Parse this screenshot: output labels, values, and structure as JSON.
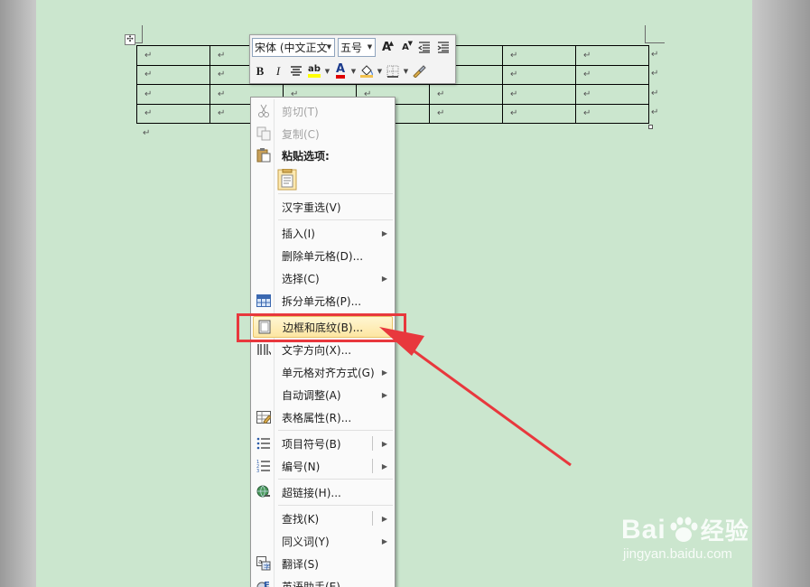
{
  "document": {
    "cell_mark": "↵",
    "rows": 4,
    "cols": 7
  },
  "mini_toolbar": {
    "font_name": "宋体 (中文正文",
    "font_size": "五号",
    "grow_font": "A",
    "shrink_font": "A",
    "bold": "B",
    "italic": "I",
    "font_color_letter": "A",
    "highlight_letter": "ab"
  },
  "context_menu": {
    "items": [
      {
        "label": "剪切(T)",
        "disabled": true
      },
      {
        "label": "复制(C)",
        "disabled": true
      },
      {
        "label": "粘贴选项:"
      },
      {
        "label": "汉字重选(V)"
      },
      {
        "label": "插入(I)",
        "submenu": true
      },
      {
        "label": "删除单元格(D)..."
      },
      {
        "label": "选择(C)",
        "submenu": true
      },
      {
        "label": "拆分单元格(P)..."
      },
      {
        "label": "边框和底纹(B)...",
        "highlighted": true
      },
      {
        "label": "文字方向(X)..."
      },
      {
        "label": "单元格对齐方式(G)",
        "submenu": true
      },
      {
        "label": "自动调整(A)",
        "submenu": true
      },
      {
        "label": "表格属性(R)..."
      },
      {
        "label": "项目符号(B)",
        "submenu": true
      },
      {
        "label": "编号(N)",
        "submenu": true
      },
      {
        "label": "超链接(H)..."
      },
      {
        "label": "查找(K)",
        "submenu": true
      },
      {
        "label": "同义词(Y)",
        "submenu": true
      },
      {
        "label": "翻译(S)"
      },
      {
        "label": "英语助手(E)"
      }
    ]
  },
  "watermark": {
    "line1": "Bai",
    "line1_b": "经验",
    "line2": "jingyan.baidu.com"
  },
  "colors": {
    "page": "#cbe6ce",
    "highlight_box": "#e8383d",
    "arrow": "#e8383d"
  }
}
